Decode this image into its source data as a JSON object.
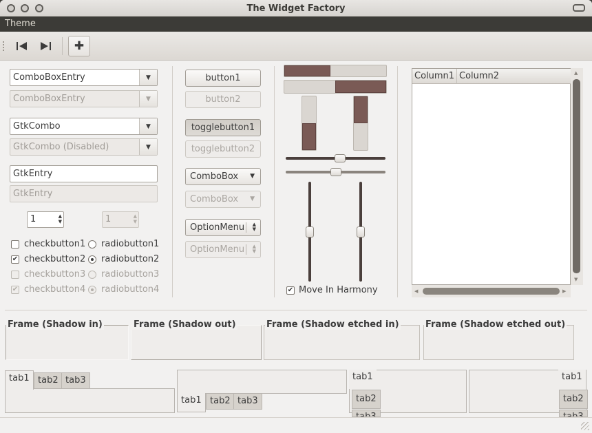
{
  "window": {
    "title": "The Widget Factory"
  },
  "menubar": {
    "theme": "Theme"
  },
  "toolbar": {
    "prev_icon": "skip-back-icon",
    "next_icon": "skip-forward-icon",
    "add_icon": "plus-icon",
    "add_glyph": "✚"
  },
  "col1": {
    "combo_entry": "ComboBoxEntry",
    "combo_entry_dis": "ComboBoxEntry",
    "gtk_combo": "GtkCombo",
    "gtk_combo_dis": "GtkCombo (Disabled)",
    "entry": "GtkEntry",
    "entry_dis": "GtkEntry",
    "spin": "1",
    "spin_dis": "1",
    "checks": [
      "checkbutton1",
      "checkbutton2",
      "checkbutton3",
      "checkbutton4"
    ],
    "radios": [
      "radiobutton1",
      "radiobutton2",
      "radiobutton3",
      "radiobutton4"
    ]
  },
  "col2": {
    "button1": "button1",
    "button2": "button2",
    "toggle1": "togglebutton1",
    "toggle2": "togglebutton2",
    "combobox": "ComboBox",
    "combobox_dis": "ComboBox",
    "optionmenu": "OptionMenu",
    "optionmenu_dis": "OptionMenu"
  },
  "col3": {
    "progress_h1": 0.45,
    "progress_h2": 0.5,
    "progress_v1": 0.5,
    "progress_v2": 0.5,
    "scale_h1": 0.55,
    "scale_h2": 0.5,
    "scale_v1": 0.5,
    "scale_v2": 0.5,
    "harmony_label": "Move In Harmony"
  },
  "tree": {
    "columns": [
      "Column1",
      "Column2"
    ]
  },
  "frames": [
    "Frame (Shadow in)",
    "Frame (Shadow out)",
    "Frame (Shadow etched in)",
    "Frame (Shadow etched out)"
  ],
  "notebooks": {
    "tabs": [
      "tab1",
      "tab2",
      "tab3"
    ]
  }
}
